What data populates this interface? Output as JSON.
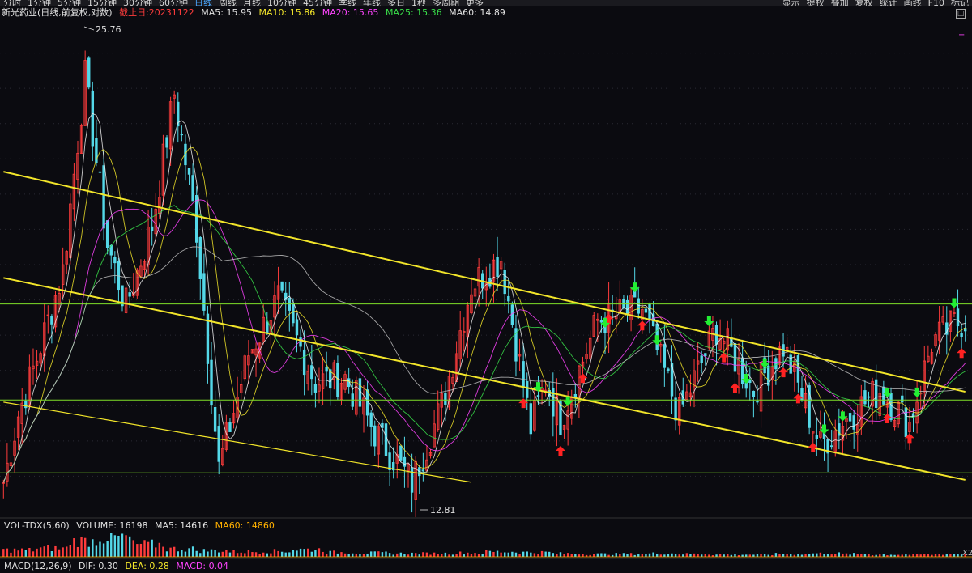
{
  "toolbar": {
    "tabs": [
      "分时",
      "1分钟",
      "5分钟",
      "15分钟",
      "30分钟",
      "60分钟",
      "日线",
      "周线",
      "月线",
      "10分钟",
      "45分钟",
      "季线",
      "年线",
      "多日",
      "1秒",
      "多周期",
      "更多"
    ],
    "active_tab": "日线",
    "right_tabs": [
      "显示",
      "提权",
      "叠加",
      "复权",
      "统计",
      "画线",
      "F10",
      "标记"
    ]
  },
  "legend": {
    "stock": "新光药业(日线,前复权,对数)",
    "cutoff": "截止日:20231122",
    "ma5": "MA5: 15.95",
    "ma10": "MA10: 15.86",
    "ma20": "MA20: 15.65",
    "ma25": "MA25: 15.36",
    "ma60": "MA60: 14.89"
  },
  "vol_legend": {
    "name": "VOL-TDX(5,60)",
    "volume": "VOLUME: 16198",
    "ma5": "MA5: 14616",
    "ma60": "MA60: 14860"
  },
  "macd_legend": {
    "name": "MACD(12,26,9)",
    "dif": "DIF: 0.30",
    "dea": "DEA: 0.28",
    "macd": "MACD: 0.04"
  },
  "ui": {
    "box_button": "□",
    "minus_button": "−",
    "corner_label": "X2"
  },
  "colors": {
    "background": "#0b0b10",
    "candle_up": "#ff3c3c",
    "candle_down": "#54d8e8",
    "ma5": "#f0f0f0",
    "ma10": "#f2e52a",
    "ma20": "#ff44ff",
    "ma25": "#39e04a",
    "ma60": "#c0c0c0",
    "trendline": "#f2e52a",
    "level_line": "#7fe028",
    "buy_arrow": "#ff2222",
    "sell_arrow": "#22ee33"
  },
  "chart_data": {
    "type": "candlestick",
    "scale": "log",
    "ylim": [
      12.3,
      27.5
    ],
    "bar_count": 260,
    "high_label": "25.76",
    "low_label": "12.81",
    "price_anchors": {
      "x": [
        0,
        4,
        9,
        16,
        22,
        28,
        33,
        40,
        46,
        52,
        58,
        66,
        74,
        84,
        92,
        100,
        110,
        118,
        126,
        134,
        142,
        146,
        150,
        160,
        172,
        182,
        192,
        202,
        210,
        220,
        228,
        236,
        244,
        250,
        256,
        259
      ],
      "price": [
        12.9,
        14.4,
        15.8,
        18.2,
        25.0,
        19.0,
        17.2,
        19.6,
        24.3,
        19.5,
        13.2,
        15.9,
        17.4,
        15.2,
        15.3,
        14.0,
        12.9,
        14.6,
        17.8,
        18.6,
        14.1,
        15.2,
        14.3,
        16.8,
        17.1,
        14.4,
        16.6,
        15.0,
        16.1,
        13.7,
        14.4,
        15.0,
        14.2,
        16.2,
        16.7,
        16.8
      ]
    },
    "levels": [
      17.25,
      14.75,
      13.1
    ],
    "trendlines": [
      {
        "from": [
          0,
          21.4
        ],
        "to": [
          259,
          14.95
        ]
      },
      {
        "from": [
          0,
          18.0
        ],
        "to": [
          259,
          12.95
        ]
      },
      {
        "from": [
          0,
          14.7
        ],
        "to": [
          126,
          12.9
        ]
      }
    ],
    "buy_signals": [
      140,
      150,
      156,
      163,
      172,
      194,
      197,
      210,
      214,
      218,
      238,
      244,
      258
    ],
    "sell_signals": [
      144,
      152,
      162,
      170,
      176,
      190,
      200,
      205,
      221,
      226,
      238,
      246,
      256
    ],
    "volume_sample": [
      1.2,
      1.5,
      2.8,
      3.4,
      2.2,
      1.4,
      1.1,
      0.9,
      1.0,
      1.3,
      0.8,
      0.7,
      0.6,
      0.6,
      0.7,
      0.9,
      0.8,
      0.6,
      0.5,
      0.5,
      0.6,
      0.5,
      0.4,
      0.4,
      0.5,
      0.6,
      0.5,
      0.4,
      0.4,
      0.5
    ]
  }
}
